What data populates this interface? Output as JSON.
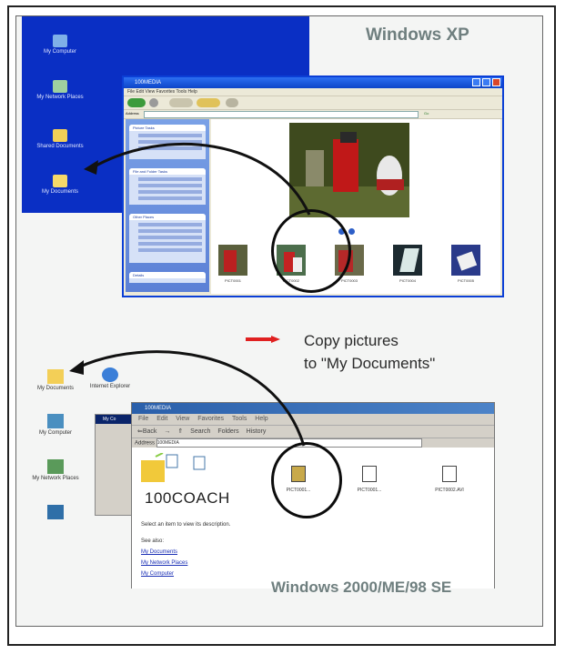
{
  "labels": {
    "xp": "Windows XP",
    "w2k": "Windows 2000/ME/98 SE",
    "copy_line1": "Copy pictures",
    "copy_line2": "to \"My Documents\""
  },
  "xp_desktop": {
    "icons": [
      "My Computer",
      "My Network Places",
      "Shared Documents",
      "My Documents"
    ]
  },
  "xp_window": {
    "title": "100MEDIA",
    "menu": "File  Edit  View  Favorites  Tools  Help",
    "toolbar_back": "Back",
    "toolbar_search": "Search",
    "toolbar_folders": "Folders",
    "address_label": "Address",
    "go": "Go",
    "tasks": [
      "Picture Tasks",
      "File and Folder Tasks",
      "Other Places",
      "Details"
    ],
    "thumbs": [
      "PICT0001",
      "PICT0002",
      "PICT0003",
      "PICT0004",
      "PICT0005"
    ]
  },
  "w2k_desktop": {
    "icons": [
      "My Documents",
      "Internet Explorer",
      "My Computer",
      "My Network Places"
    ]
  },
  "back_window": {
    "title": "My Co"
  },
  "w2k_window": {
    "title": "100MEDIA",
    "menu": [
      "File",
      "Edit",
      "View",
      "Favorites",
      "Tools",
      "Help"
    ],
    "toolbar": [
      "⇐Back",
      "→",
      "⇑",
      "Search",
      "Folders",
      "History"
    ],
    "address_label": "Address",
    "address_value": "100MEDIA",
    "folder_name": "100COACH",
    "description": "Select an item to view its description.",
    "see_also": "See also:",
    "links": [
      "My Documents",
      "My Network Places",
      "My Computer"
    ],
    "files": [
      "PICT0001...",
      "PICT0001...",
      "PICT0002.AVI"
    ]
  },
  "colors": {
    "xp_blue": "#0a2fc4",
    "arrow_red": "#e02020",
    "label_gray": "#6f7f7f"
  }
}
